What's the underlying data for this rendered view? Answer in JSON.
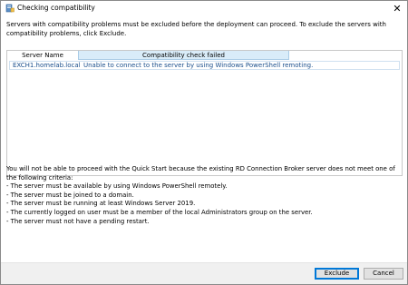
{
  "window": {
    "title": "Checking compatibility",
    "icon": "server-manager-icon",
    "close_glyph": "✕"
  },
  "intro_text": "Servers with compatibility problems must be excluded before the deployment can proceed. To exclude the servers with compatibility problems, click Exclude.",
  "grid": {
    "columns": [
      "Server Name",
      "Compatibility check failed"
    ],
    "rows": [
      {
        "server_name": "EXCH1.homelab.local",
        "status": "Unable to connect to the server by using Windows PowerShell remoting."
      }
    ]
  },
  "requirements": {
    "intro": "You will not be able to proceed with the Quick Start because the existing RD Connection Broker server does not meet one of the following criteria:",
    "items": [
      "- The server must be available by using Windows PowerShell remotely.",
      "- The server must be joined to a domain.",
      "- The server must be running at least Windows Server 2019.",
      "- The currently logged on user must be a member of the local Administrators group on the server.",
      "- The server must not have a pending restart."
    ]
  },
  "buttons": {
    "exclude": "Exclude",
    "cancel": "Cancel"
  },
  "colors": {
    "header_highlight": "#d9ecf9",
    "link_text": "#1b4f8c",
    "default_button_border": "#0078d7"
  }
}
